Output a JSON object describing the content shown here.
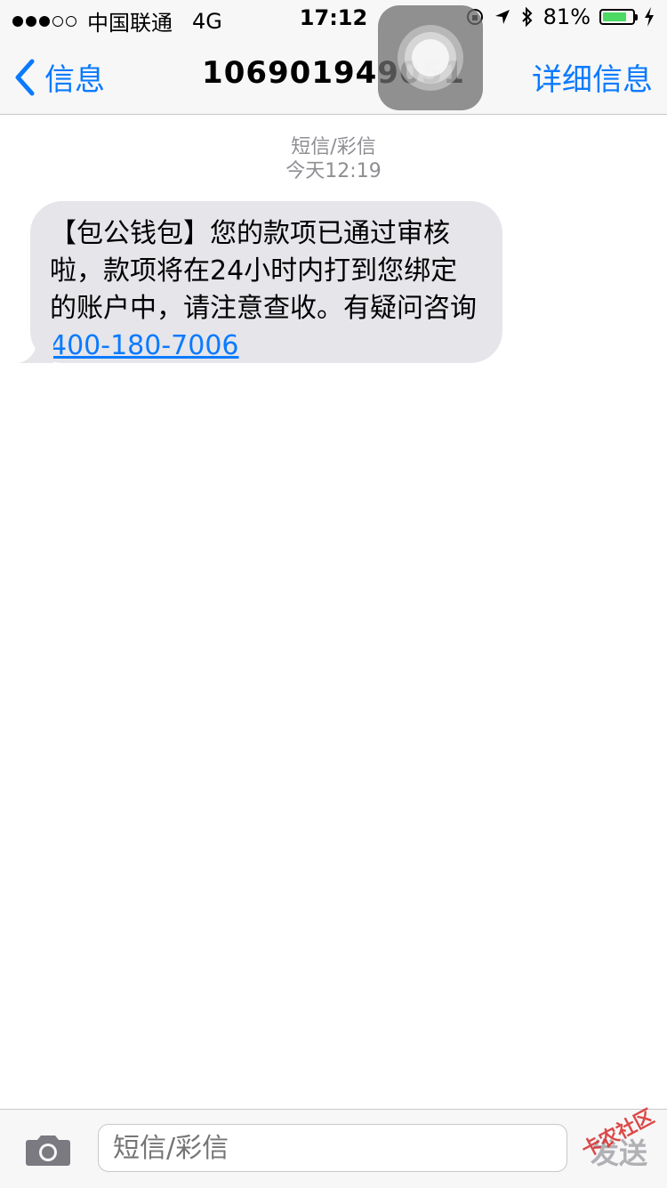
{
  "status_bar": {
    "carrier": "中国联通",
    "network": "4G",
    "time": "17:12",
    "battery": "81%",
    "battery_level": 0.81
  },
  "nav": {
    "back_label": "信息",
    "title": "106901949051",
    "detail_label": "详细信息"
  },
  "thread": {
    "type_label": "短信/彩信",
    "time_label": "今天12:19",
    "message_text": "【包公钱包】您的款项已通过审核啦，款项将在24小时内打到您绑定的账户中，请注意查收。有疑问咨询",
    "message_phone": "400-180-7006"
  },
  "composer": {
    "placeholder": "短信/彩信",
    "send_label": "发送"
  },
  "watermark": "卡农社区",
  "colors": {
    "accent": "#0a7aff",
    "bubble": "#e5e5ea",
    "battery": "#4cd964"
  }
}
